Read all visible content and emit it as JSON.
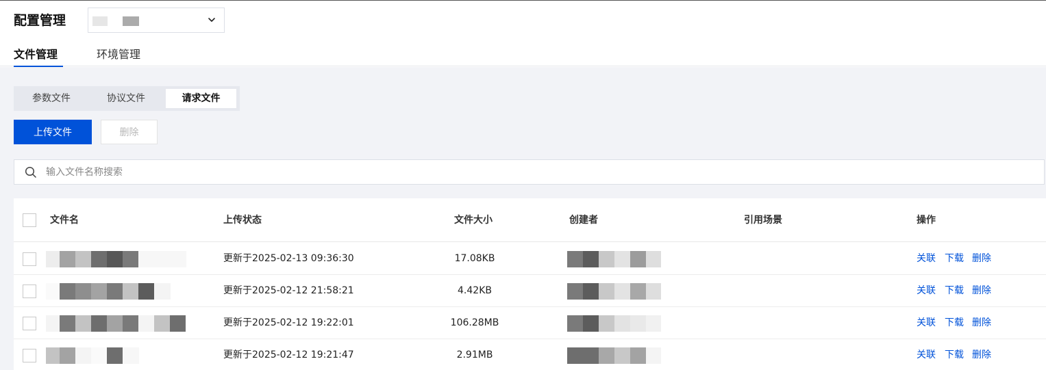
{
  "header": {
    "title": "配置管理",
    "tabs": [
      "文件管理",
      "环境管理"
    ]
  },
  "segments": [
    "参数文件",
    "协议文件",
    "请求文件"
  ],
  "active_segment": "请求文件",
  "actions": {
    "upload": "上传文件",
    "delete": "删除"
  },
  "search": {
    "placeholder": "输入文件名称搜索"
  },
  "table": {
    "columns": [
      "文件名",
      "上传状态",
      "文件大小",
      "创建者",
      "引用场景",
      "操作"
    ],
    "rows": [
      {
        "status": "更新于2025-02-13 09:36:30",
        "size": "17.08KB",
        "scene": "",
        "ops": [
          "关联",
          "下载",
          "删除"
        ]
      },
      {
        "status": "更新于2025-02-12 21:58:21",
        "size": "4.42KB",
        "scene": "",
        "ops": [
          "关联",
          "下载",
          "删除"
        ]
      },
      {
        "status": "更新于2025-02-12 19:22:01",
        "size": "106.28MB",
        "scene": "",
        "ops": [
          "关联",
          "下载",
          "删除"
        ]
      },
      {
        "status": "更新于2025-02-12 19:21:47",
        "size": "2.91MB",
        "scene": "",
        "ops": [
          "关联",
          "下载",
          "删除"
        ]
      }
    ]
  },
  "colors": {
    "primary": "#0052d9",
    "background": "#f2f3f7"
  }
}
